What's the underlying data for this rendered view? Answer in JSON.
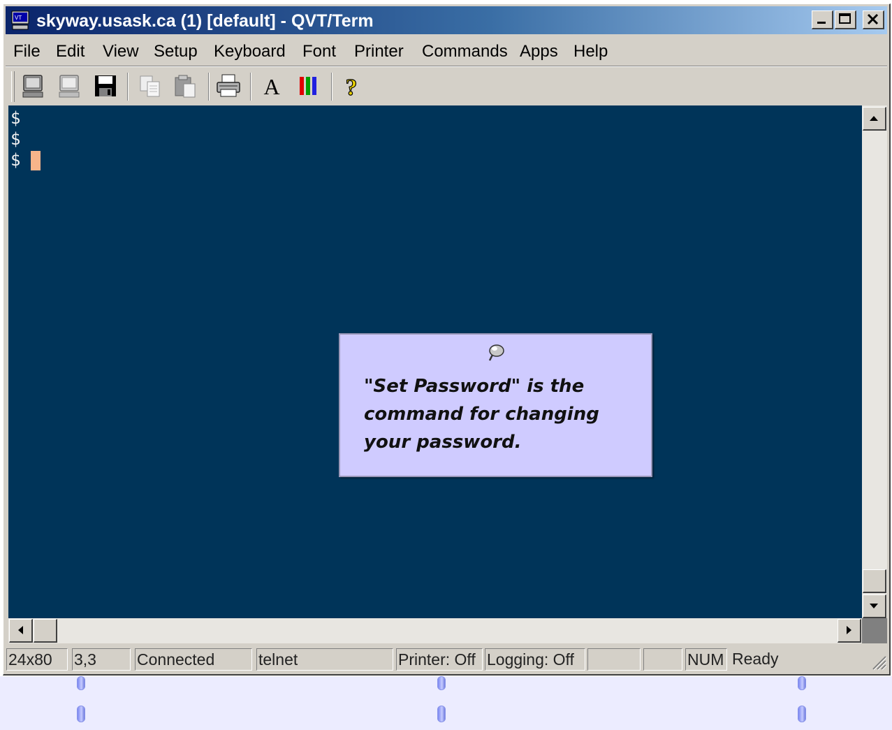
{
  "window": {
    "title": "skyway.usask.ca (1) [default] - QVT/Term",
    "controls": {
      "minimize": "_",
      "maximize": "□",
      "close": "×"
    }
  },
  "menu": [
    "File",
    "Edit",
    "View",
    "Setup",
    "Keyboard",
    "Font",
    "Printer",
    "Commands",
    "Apps",
    "Help"
  ],
  "toolbar": {
    "font_button_label": "A",
    "help_button_label": "?",
    "icons": [
      "terminal-icon",
      "terminal-alt-icon",
      "save-icon",
      "copy-icon",
      "paste-icon",
      "print-icon",
      "font-icon",
      "colors-icon",
      "help-icon"
    ]
  },
  "terminal": {
    "lines": [
      "$",
      "$",
      "$"
    ],
    "background": "#003459",
    "cursor_color": "#f7b58a"
  },
  "status": {
    "size": "24x80",
    "cursor_pos": "3,3",
    "connection": "Connected",
    "protocol": "telnet",
    "printer": "Printer: Off",
    "logging": "Logging: Off",
    "empty1": "",
    "empty2": "",
    "num": "NUM",
    "ready": "Ready"
  },
  "tooltip": {
    "text": "\"Set Password\" is the command for changing your password.",
    "background": "#cfcbff"
  }
}
